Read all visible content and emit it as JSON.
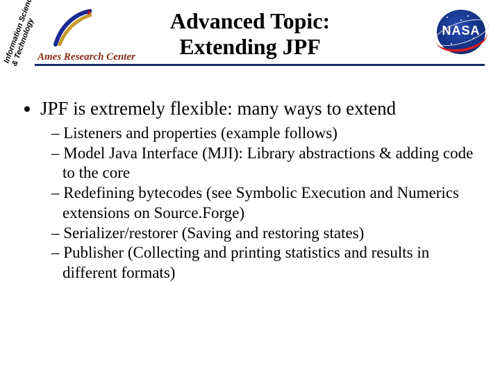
{
  "header": {
    "title_line1": "Advanced Topic:",
    "title_line2": "Extending JPF",
    "ames_label": "Ames Research Center",
    "ames_arc_text": "Information Sciences & Technology",
    "nasa_text": "NASA"
  },
  "body": {
    "bullet1": "JPF is extremely flexible: many ways to extend",
    "subs": [
      "Listeners and properties (example follows)",
      "Model Java Interface (MJI): Library abstractions & adding code to the core",
      "Redefining bytecodes (see Symbolic Execution and Numerics extensions on Source.Forge)",
      "Serializer/restorer (Saving and restoring states)",
      "Publisher (Collecting and printing statistics and results in different formats)"
    ]
  }
}
